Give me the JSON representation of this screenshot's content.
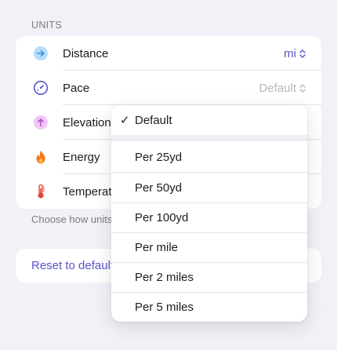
{
  "section": {
    "header": "UNITS"
  },
  "rows": [
    {
      "label": "Distance",
      "value": "mi",
      "icon": "arrow-right-circle-icon",
      "color": "#4aa8f0"
    },
    {
      "label": "Pace",
      "value": "Default",
      "icon": "stopwatch-icon",
      "color": "#5b53c7"
    },
    {
      "label": "Elevation",
      "value": "",
      "icon": "arrow-up-circle-icon",
      "color": "#d58be0"
    },
    {
      "label": "Energy",
      "value": "",
      "icon": "flame-icon",
      "color": "#f27a1a"
    },
    {
      "label": "Temperat",
      "value": "",
      "icon": "thermometer-icon",
      "color": "#e0483a"
    }
  ],
  "footer": {
    "text": "Choose how units"
  },
  "reset": {
    "label": "Reset to default"
  },
  "menu": {
    "selected": "Default",
    "checkmark": "✓",
    "options": [
      "Per 25yd",
      "Per 50yd",
      "Per 100yd",
      "Per mile",
      "Per 2 miles",
      "Per 5 miles"
    ]
  },
  "colors": {
    "accent": "#5b53c7",
    "muted": "#b6b6bb",
    "background": "#f2f1f7"
  }
}
